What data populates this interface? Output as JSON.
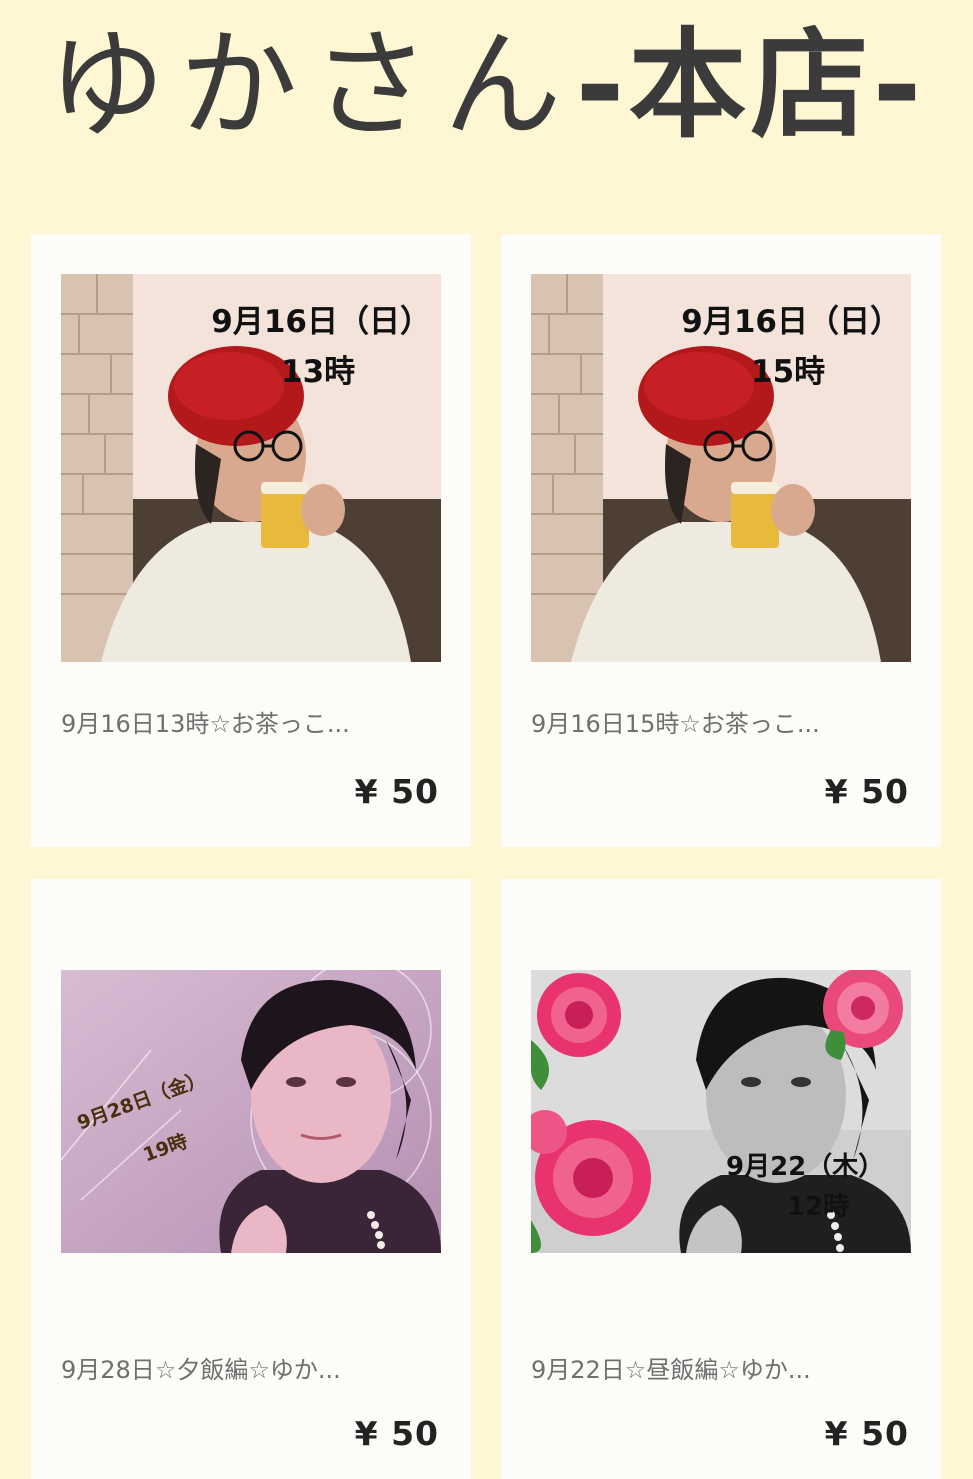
{
  "store": {
    "title_prefix": "ゆかさん",
    "title_suffix": "-本店-"
  },
  "items": [
    {
      "overlay_date": "9月16日（日）",
      "overlay_time": "13時",
      "title": "9月16日13時☆お茶っこ...",
      "price": "¥ 50"
    },
    {
      "overlay_date": "9月16日（日）",
      "overlay_time": "15時",
      "title": "9月16日15時☆お茶っこ...",
      "price": "¥ 50"
    },
    {
      "overlay_date": "9月28日（金）",
      "overlay_time": "19時",
      "title": "9月28日☆夕飯編☆ゆか...",
      "price": "¥ 50"
    },
    {
      "overlay_date": "9月22（木）",
      "overlay_time": "12時",
      "title": "9月22日☆昼飯編☆ゆか...",
      "price": "¥ 50"
    }
  ],
  "colors": {
    "page_background": "#fff6d3",
    "card_background": "#fdfcf9",
    "title_text": "#3b3b3b",
    "item_title_text": "#6f6f6f",
    "price_text": "#222222"
  }
}
